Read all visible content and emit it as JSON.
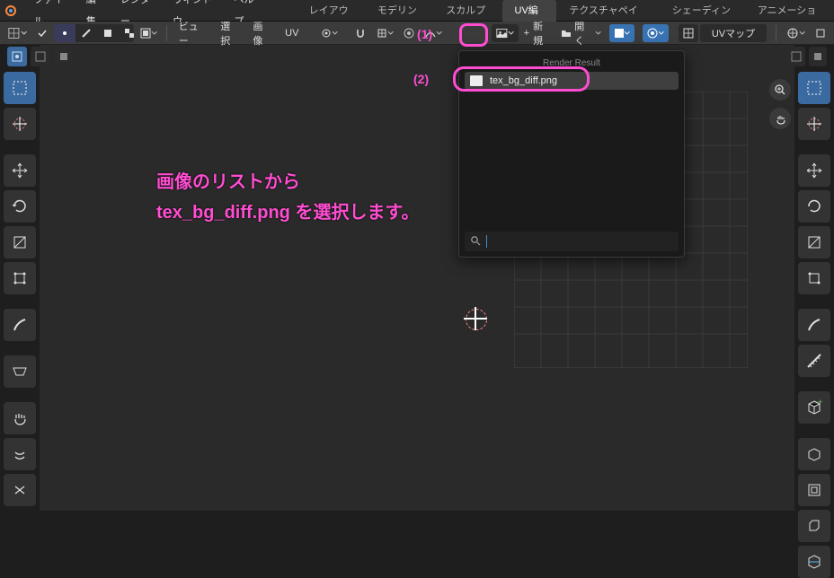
{
  "topmenu": {
    "items": [
      "ファイル",
      "編集",
      "レンダー",
      "ウィンドウ",
      "ヘルプ"
    ]
  },
  "workspaces": {
    "tabs": [
      "レイアウト",
      "モデリング",
      "スカルプト",
      "UV編集",
      "テクスチャペイント",
      "シェーディング",
      "アニメーション"
    ],
    "active": 3
  },
  "header2": {
    "view": "ビュー",
    "select": "選択",
    "image": "画像",
    "uv": "UV",
    "new": "新規",
    "open": "開く",
    "uvmap": "UVマップ"
  },
  "dropdown": {
    "title": "Render Result",
    "items": [
      {
        "name": "tex_bg_diff.png"
      }
    ],
    "search_placeholder": ""
  },
  "callouts": {
    "one": "(1)",
    "two": "(2)"
  },
  "annotation": {
    "line1": "画像のリストから",
    "line2": "tex_bg_diff.png を選択します。"
  },
  "icons": {
    "plus": "+"
  }
}
